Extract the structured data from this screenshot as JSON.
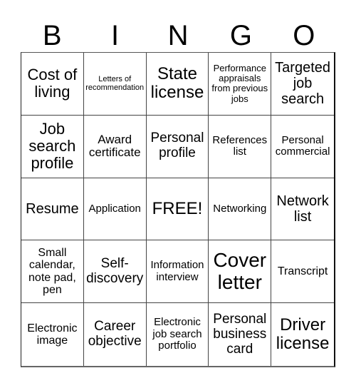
{
  "header": {
    "letters": [
      "B",
      "I",
      "N",
      "G",
      "O"
    ]
  },
  "cells": [
    [
      "Cost of living",
      "Letters of recommendation",
      "State license",
      "Performance appraisals from previous jobs",
      "Targeted job search"
    ],
    [
      "Job search profile",
      "Award certificate",
      "Personal profile",
      "References list",
      "Personal commercial"
    ],
    [
      "Resume",
      "Application",
      "FREE!",
      "Networking",
      "Network list"
    ],
    [
      "Small calendar, note pad, pen",
      "Self-discovery",
      "Information interview",
      "Cover letter",
      "Transcript"
    ],
    [
      "Electronic image",
      "Career objective",
      "Electronic job search portfolio",
      "Personal business card",
      "Driver license"
    ]
  ]
}
